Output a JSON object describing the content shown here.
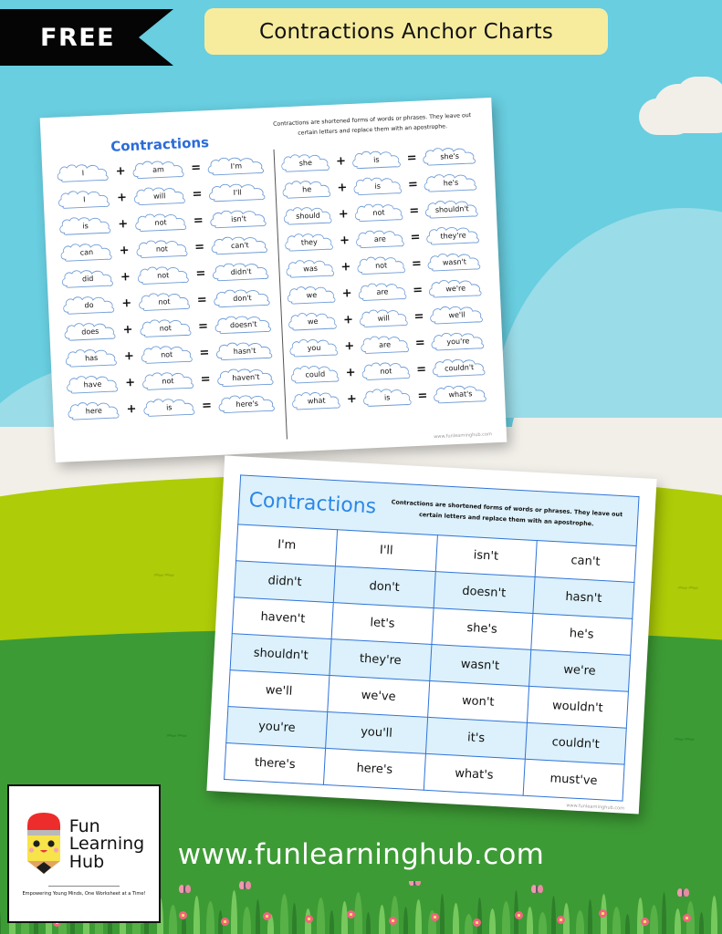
{
  "banner": {
    "free_label": "FREE",
    "title": "Contractions Anchor Charts"
  },
  "worksheet_cloud": {
    "title": "Contractions",
    "description": "Contractions are shortened forms of words or phrases. They leave out certain letters and replace them with an apostrophe.",
    "plus_symbol": "+",
    "equals_symbol": "=",
    "footer": "www.funlearninghub.com",
    "left_rows": [
      {
        "word1": "I",
        "word2": "am",
        "result": "I'm"
      },
      {
        "word1": "I",
        "word2": "will",
        "result": "I'll"
      },
      {
        "word1": "is",
        "word2": "not",
        "result": "isn't"
      },
      {
        "word1": "can",
        "word2": "not",
        "result": "can't"
      },
      {
        "word1": "did",
        "word2": "not",
        "result": "didn't"
      },
      {
        "word1": "do",
        "word2": "not",
        "result": "don't"
      },
      {
        "word1": "does",
        "word2": "not",
        "result": "doesn't"
      },
      {
        "word1": "has",
        "word2": "not",
        "result": "hasn't"
      },
      {
        "word1": "have",
        "word2": "not",
        "result": "haven't"
      },
      {
        "word1": "here",
        "word2": "is",
        "result": "here's"
      }
    ],
    "right_rows": [
      {
        "word1": "she",
        "word2": "is",
        "result": "she's"
      },
      {
        "word1": "he",
        "word2": "is",
        "result": "he's"
      },
      {
        "word1": "should",
        "word2": "not",
        "result": "shouldn't"
      },
      {
        "word1": "they",
        "word2": "are",
        "result": "they're"
      },
      {
        "word1": "was",
        "word2": "not",
        "result": "wasn't"
      },
      {
        "word1": "we",
        "word2": "are",
        "result": "we're"
      },
      {
        "word1": "we",
        "word2": "will",
        "result": "we'll"
      },
      {
        "word1": "you",
        "word2": "are",
        "result": "you're"
      },
      {
        "word1": "could",
        "word2": "not",
        "result": "couldn't"
      },
      {
        "word1": "what",
        "word2": "is",
        "result": "what's"
      }
    ]
  },
  "worksheet_table": {
    "title": "Contractions",
    "description": "Contractions are shortened forms of words or phrases. They leave out certain letters and replace them with an apostrophe.",
    "footer": "www.funlearninghub.com",
    "rows": [
      [
        "I'm",
        "I'll",
        "isn't",
        "can't"
      ],
      [
        "didn't",
        "don't",
        "doesn't",
        "hasn't"
      ],
      [
        "haven't",
        "let's",
        "she's",
        "he's"
      ],
      [
        "shouldn't",
        "they're",
        "wasn't",
        "we're"
      ],
      [
        "we'll",
        "we've",
        "won't",
        "wouldn't"
      ],
      [
        "you're",
        "you'll",
        "it's",
        "couldn't"
      ],
      [
        "there's",
        "here's",
        "what's",
        "must've"
      ]
    ]
  },
  "logo": {
    "line1": "Fun",
    "line2": "Learning",
    "line3": "Hub",
    "tagline": "Empowering Young Minds, One Worksheet at a Time!"
  },
  "site_url": "www.funlearninghub.com",
  "colors": {
    "sky": "#68CEE0",
    "hill_lightblue": "#9ADCE8",
    "cloud_white": "#F2EFE9",
    "hill_lime": "#AECC07",
    "hill_green": "#3D9B35",
    "title_pill": "#F7EC9E",
    "ribbon": "#050505",
    "table_border": "#2F73D9",
    "table_shade": "#DCF1FB",
    "heading_blue": "#2B87E8",
    "cloud_outline": "#6E9BD6"
  }
}
